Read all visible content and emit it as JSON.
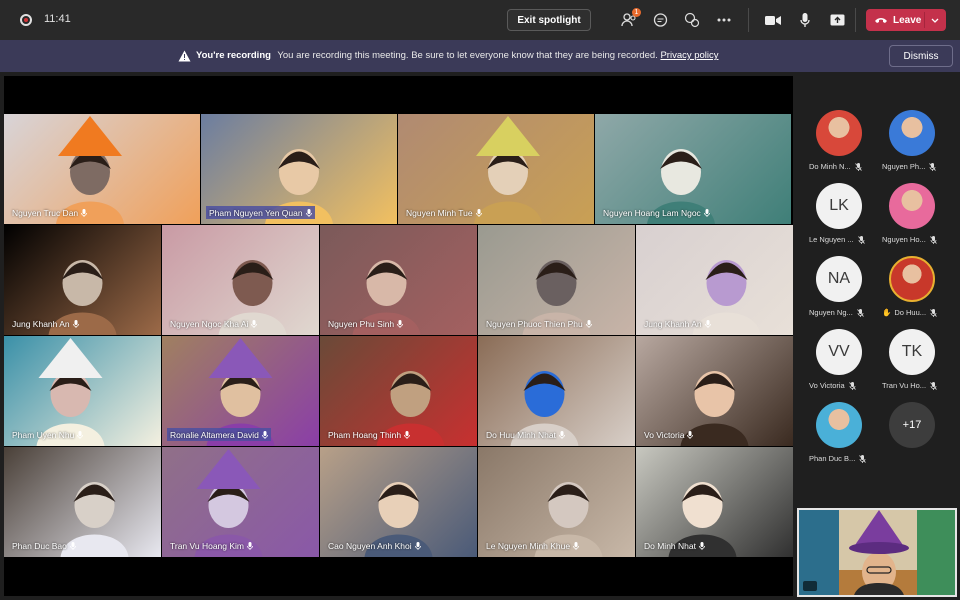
{
  "topbar": {
    "time": "11:41",
    "exit_spotlight_label": "Exit spotlight",
    "participants_badge": "1",
    "leave_label": "Leave"
  },
  "banner": {
    "title": "You're recording",
    "message": "You are recording this meeting. Be sure to let everyone know that they are being recorded.",
    "link": "Privacy policy",
    "dismiss_label": "Dismiss"
  },
  "tiles": [
    {
      "name": "Nguyen Truc Dan"
    },
    {
      "name": "Pham Nguyen Yen Quan",
      "highlight": true
    },
    {
      "name": "Nguyen Minh Tue"
    },
    {
      "name": "Nguyen Hoang Lam Ngoc"
    },
    {
      "name": "Jung Khanh An"
    },
    {
      "name": "Nguyen Ngoc Kha Ai"
    },
    {
      "name": "Nguyen Phu Sinh"
    },
    {
      "name": "Nguyen Phuoc Thien Phu"
    },
    {
      "name": "Jung Khanh An"
    },
    {
      "name": "Pham Uyen Nhu"
    },
    {
      "name": "Ronalie Altamera David",
      "highlight": true
    },
    {
      "name": "Pham Hoang Thinh"
    },
    {
      "name": "Do Huu Minh Nhat"
    },
    {
      "name": "Vo Victoria"
    },
    {
      "name": "Phan Duc Bao"
    },
    {
      "name": "Tran Vu Hoang Kim"
    },
    {
      "name": "Cao Nguyen Anh Khoi"
    },
    {
      "name": "Le Nguyen Minh Khue"
    },
    {
      "name": "Do Minh Nhat"
    }
  ],
  "side_participants": [
    {
      "name": "Do Minh N...",
      "initials": ""
    },
    {
      "name": "Nguyen Ph...",
      "initials": ""
    },
    {
      "name": "Le Nguyen ...",
      "initials": "LK"
    },
    {
      "name": "Nguyen Ho...",
      "initials": ""
    },
    {
      "name": "Nguyen Ng...",
      "initials": "NA"
    },
    {
      "name": "Do Huu...",
      "initials": ""
    },
    {
      "name": "Vo Victoria",
      "initials": "VV"
    },
    {
      "name": "Tran Vu Ho...",
      "initials": "TK"
    },
    {
      "name": "Phan Duc B...",
      "initials": ""
    }
  ],
  "more_count": "+17",
  "colors": {
    "leave": "#c4314b",
    "banner": "#3b3a58",
    "highlight": "#4c50a0"
  }
}
